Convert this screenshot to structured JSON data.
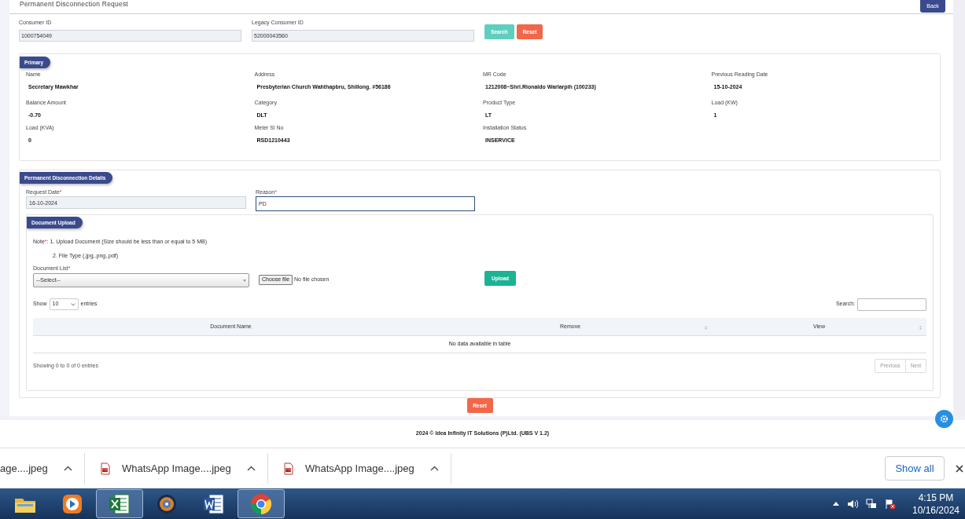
{
  "page": {
    "title": "Permanent Disconnection Request",
    "back_button": "Back"
  },
  "search": {
    "fields": [
      {
        "label": "Consumer ID",
        "value": "1000754049"
      },
      {
        "label": "Legacy Consumer ID",
        "value": "52000043560"
      }
    ],
    "buttons": [
      {
        "label": "Search",
        "kind": "search"
      },
      {
        "label": "Reset",
        "kind": "reset"
      }
    ]
  },
  "primary": {
    "title": "Primary",
    "fields": [
      {
        "label": "Name",
        "value": "Secretary  Mawkhar"
      },
      {
        "label": "Address",
        "value": "Presbyterian Church Wahthapbru, Shillong.  #56186"
      },
      {
        "label": "MR Code",
        "value": "1212008~Shri.Rionaldo Warlarpih (100233)"
      },
      {
        "label": "Previous Reading Date",
        "value": "15-10-2024"
      },
      {
        "label": "Balance Amount",
        "value": "-0.70"
      },
      {
        "label": "Category",
        "value": "DLT"
      },
      {
        "label": "Product Type",
        "value": "LT"
      },
      {
        "label": "Load (KW)",
        "value": "1"
      },
      {
        "label": "Load (KVA)",
        "value": "0"
      },
      {
        "label": "Meter Sl No",
        "value": "RSD1210443"
      },
      {
        "label": "Installation Status",
        "value": "INSERVICE"
      }
    ]
  },
  "details": {
    "title": "Permanent Disconnection Details",
    "fields": [
      {
        "label": "Request Date",
        "mark": "*",
        "value": "16-10-2024",
        "focused": false
      },
      {
        "label": "Reason",
        "mark": "*",
        "value": "PD",
        "focused": true
      }
    ]
  },
  "upload": {
    "title": "Document Upload",
    "note": {
      "label": "Note",
      "mark": "*",
      "lines": [
        ": 1. Upload Document (Size should be less than or equal to 5 MB)",
        "2. File Type (.jpg,.png,.pdf)"
      ]
    },
    "document_list": {
      "label": "Document List",
      "mark": "*",
      "value": "--Select--"
    },
    "file_input": {
      "button": "Choose file",
      "status": "No file chosen"
    },
    "upload_button": "Upload",
    "table": {
      "show_label": "Show",
      "page_size": "10",
      "entries_label": "entries",
      "search_label": "Search:",
      "columns": [
        {
          "label": "Document Name",
          "sortable": false
        },
        {
          "label": "Remove",
          "sortable": true
        },
        {
          "label": "View",
          "sortable": true
        }
      ],
      "empty_message": "No data available in table",
      "info": "Showing 0 to 0 of 0 entries",
      "pagination": [
        {
          "label": "Previous",
          "disabled": true
        },
        {
          "label": "Next",
          "disabled": true
        }
      ]
    }
  },
  "reset_button": "Reset",
  "footer": "2024 © Idea Infinity IT Solutions (P)Ltd. (UBS V 1.2)",
  "downloads": {
    "items": [
      {
        "name": "age....jpeg",
        "kind": "partial"
      },
      {
        "name": "WhatsApp Image....jpeg",
        "kind": "full"
      },
      {
        "name": "WhatsApp Image....jpeg",
        "kind": "full"
      }
    ],
    "show_all": "Show all"
  },
  "taskbar": {
    "apps": [
      {
        "kind": "folder",
        "selected": false
      },
      {
        "kind": "player",
        "selected": false
      },
      {
        "kind": "spreadsheet",
        "selected": true
      },
      {
        "kind": "orb",
        "selected": false
      },
      {
        "kind": "document",
        "selected": false
      },
      {
        "kind": "browser",
        "selected": true
      }
    ],
    "clock": {
      "time": "4:15 PM",
      "date": "10/16/2024"
    }
  }
}
